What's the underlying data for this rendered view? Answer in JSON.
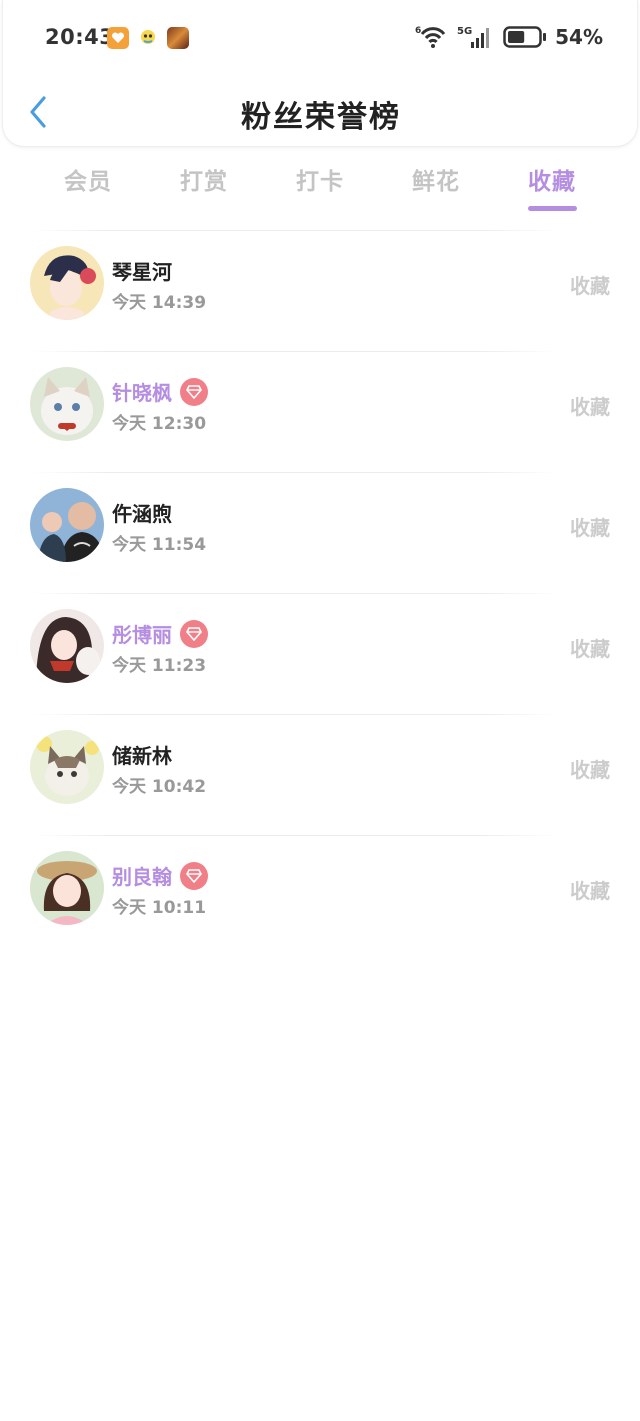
{
  "status_bar": {
    "time": "20:43",
    "battery_percent": "54%",
    "signal_label": "5G",
    "wifi_label": "6",
    "battery_level": 0.54,
    "icons": [
      "app-orange-heart-icon",
      "app-cartoon-icon",
      "app-game-icon",
      "wifi-icon",
      "signal-icon",
      "battery-icon"
    ]
  },
  "header": {
    "title": "粉丝荣誉榜",
    "back_icon": "chevron-left-icon",
    "accent": "#4a9de0"
  },
  "tabs": [
    {
      "label": "会员",
      "active": false
    },
    {
      "label": "打赏",
      "active": false
    },
    {
      "label": "打卡",
      "active": false
    },
    {
      "label": "鲜花",
      "active": false
    },
    {
      "label": "收藏",
      "active": true
    }
  ],
  "colors": {
    "active": "#b58ee2",
    "inactive": "#c4c4c4",
    "vip_badge": "#f07f88"
  },
  "fans": [
    {
      "name": "琴星河",
      "time": "今天 14:39",
      "action": "收藏",
      "vip": false,
      "avatar": "avatar-anime-girl-red-flower"
    },
    {
      "name": "针晓枫",
      "time": "今天 12:30",
      "action": "收藏",
      "vip": true,
      "avatar": "avatar-white-cat"
    },
    {
      "name": "仵涵煦",
      "time": "今天 11:54",
      "action": "收藏",
      "vip": false,
      "avatar": "avatar-man-with-baby"
    },
    {
      "name": "彤博丽",
      "time": "今天 11:23",
      "action": "收藏",
      "vip": true,
      "avatar": "avatar-anime-girl-cat"
    },
    {
      "name": "储新林",
      "time": "今天 10:42",
      "action": "收藏",
      "vip": false,
      "avatar": "avatar-kitten-flowers"
    },
    {
      "name": "别良翰",
      "time": "今天 10:11",
      "action": "收藏",
      "vip": true,
      "avatar": "avatar-girl-hat"
    }
  ]
}
